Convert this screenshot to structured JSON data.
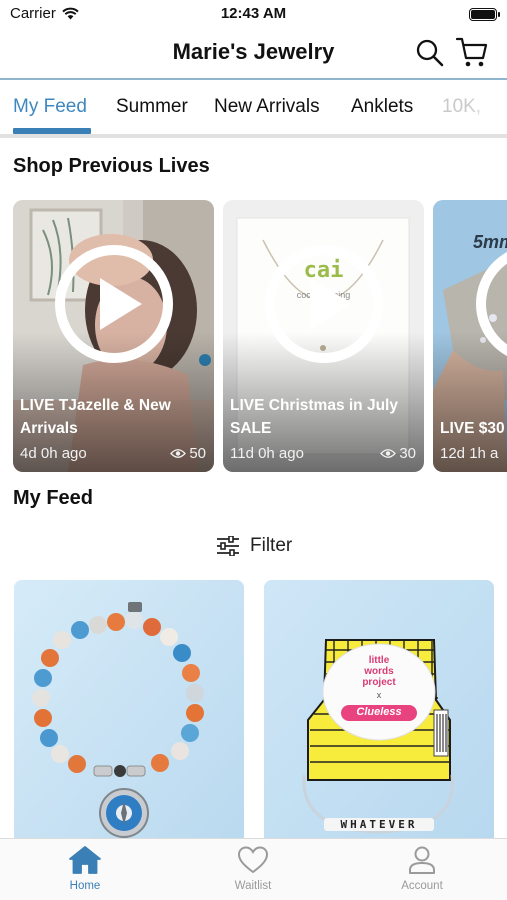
{
  "status_bar": {
    "carrier": "Carrier",
    "time": "12:43 AM"
  },
  "header": {
    "title": "Marie's Jewelry",
    "search_icon": "search-icon",
    "cart_icon": "cart-icon"
  },
  "tabs": [
    {
      "label": "My Feed",
      "active": true
    },
    {
      "label": "Summer"
    },
    {
      "label": "New Arrivals"
    },
    {
      "label": "Anklets"
    },
    {
      "label": "10K,"
    }
  ],
  "previous_lives": {
    "title": "Shop Previous Lives",
    "cards": [
      {
        "title": "LIVE TJazelle & New Arrivals",
        "ago": "4d 0h ago",
        "views": "50"
      },
      {
        "title": "LIVE Christmas in July SALE",
        "ago": "11d 0h ago",
        "views": "30",
        "photo_text": "cai",
        "photo_caption": "cool meaning"
      },
      {
        "title": "LIVE $30",
        "ago": "12d 1h a",
        "photo_text": "5mm"
      }
    ]
  },
  "feed": {
    "title": "My Feed",
    "filter_label": "Filter",
    "products": [
      {
        "kind": "beaded bracelet with compass charm"
      },
      {
        "kind": "beaded word bracelet",
        "tag_lines": [
          "little",
          "words",
          "project"
        ],
        "tag_x": "x",
        "tag_brand": "Clueless",
        "word": "WHATEVER"
      }
    ]
  },
  "bottom_nav": [
    {
      "label": "Home",
      "icon": "home-icon",
      "active": true
    },
    {
      "label": "Waitlist",
      "icon": "heart-icon"
    },
    {
      "label": "Account",
      "icon": "account-icon"
    }
  ],
  "colors": {
    "accent": "#3a7fb6",
    "active_tab": "#3e88c0",
    "header_line": "#8fb6cf"
  }
}
